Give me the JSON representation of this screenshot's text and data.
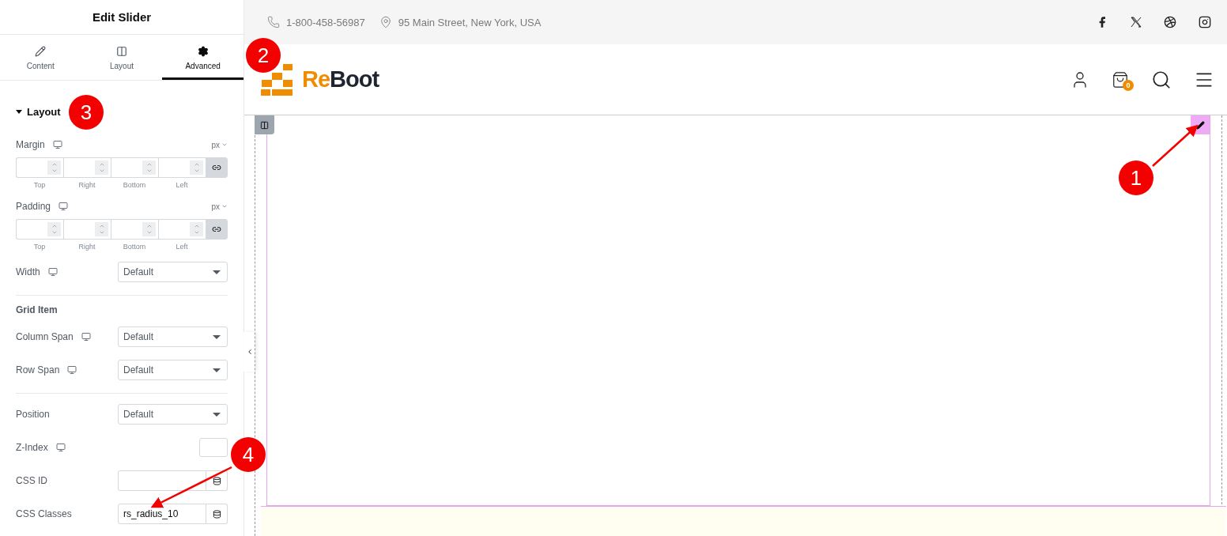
{
  "panel": {
    "title": "Edit Slider",
    "tabs": [
      {
        "label": "Content",
        "selected": false
      },
      {
        "label": "Layout",
        "selected": false
      },
      {
        "label": "Advanced",
        "selected": true
      }
    ],
    "section": {
      "title": "Layout",
      "expanded": true
    },
    "controls": [
      {
        "kind": "dimensions",
        "label": "Margin",
        "responsive": true,
        "unit": "px",
        "linked": true,
        "sides": [
          "Top",
          "Right",
          "Bottom",
          "Left"
        ]
      },
      {
        "kind": "dimensions",
        "label": "Padding",
        "responsive": true,
        "unit": "px",
        "linked": true,
        "sides": [
          "Top",
          "Right",
          "Bottom",
          "Left"
        ]
      },
      {
        "kind": "select",
        "label": "Width",
        "responsive": true,
        "value": "Default"
      },
      {
        "kind": "divider"
      },
      {
        "kind": "heading",
        "label": "Grid Item"
      },
      {
        "kind": "select",
        "label": "Column Span",
        "responsive": true,
        "value": "Default"
      },
      {
        "kind": "select",
        "label": "Row Span",
        "responsive": true,
        "value": "Default"
      },
      {
        "kind": "divider"
      },
      {
        "kind": "select",
        "label": "Position",
        "responsive": false,
        "value": "Default"
      },
      {
        "kind": "number",
        "label": "Z-Index",
        "responsive": true
      },
      {
        "kind": "text",
        "label": "CSS ID",
        "responsive": false
      },
      {
        "kind": "text",
        "label": "CSS Classes",
        "responsive": false,
        "value": "rs_radius_10"
      }
    ]
  },
  "site": {
    "phone": "1-800-458-56987",
    "address": "95 Main Street, New York, USA",
    "logo": {
      "part_1": "Re",
      "part_2": "Boot"
    },
    "cart_count": "0"
  },
  "annotations": [
    {
      "label": "1"
    },
    {
      "label": "2"
    },
    {
      "label": "3"
    },
    {
      "label": "4"
    }
  ]
}
